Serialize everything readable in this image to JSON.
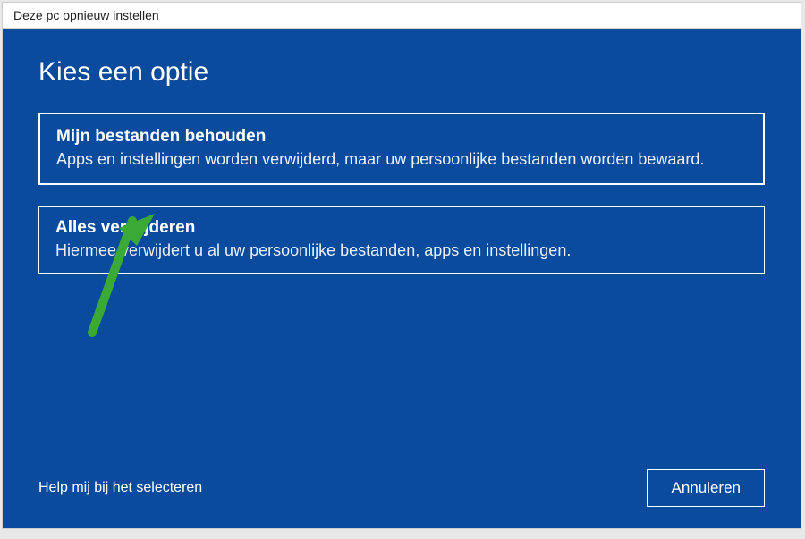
{
  "window": {
    "title": "Deze pc opnieuw instellen"
  },
  "heading": "Kies een optie",
  "options": [
    {
      "title": "Mijn bestanden behouden",
      "description": "Apps en instellingen worden verwijderd, maar uw persoonlijke bestanden worden bewaard."
    },
    {
      "title": "Alles verwijderen",
      "description": "Hiermee verwijdert u al uw persoonlijke bestanden, apps en instellingen."
    }
  ],
  "footer": {
    "help_label": "Help mij bij het selecteren",
    "cancel_label": "Annuleren"
  },
  "colors": {
    "background": "#0a4b9e",
    "arrow": "#3aa935"
  }
}
